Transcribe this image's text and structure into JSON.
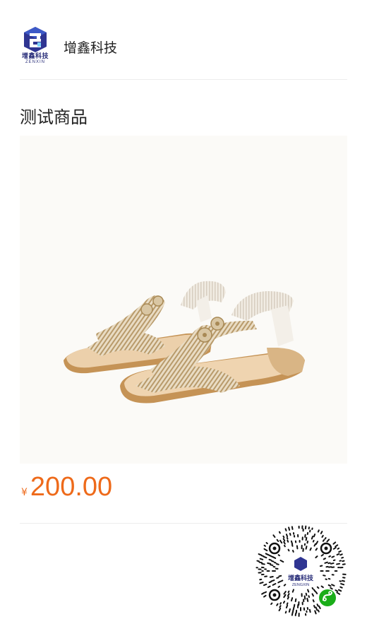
{
  "brand": {
    "logo_text_cn": "增鑫科技",
    "logo_text_en": "ZENXIN",
    "name": "增鑫科技"
  },
  "product": {
    "title": "测试商品",
    "currency_symbol": "¥",
    "price": "200.00"
  },
  "qr_code": {
    "center_text_cn": "增鑫科技",
    "center_text_en": "ZENGXIN"
  },
  "colors": {
    "price": "#ee6a1a",
    "logo_blue": "#2a2f7a",
    "wechat_green": "#1aad19"
  }
}
